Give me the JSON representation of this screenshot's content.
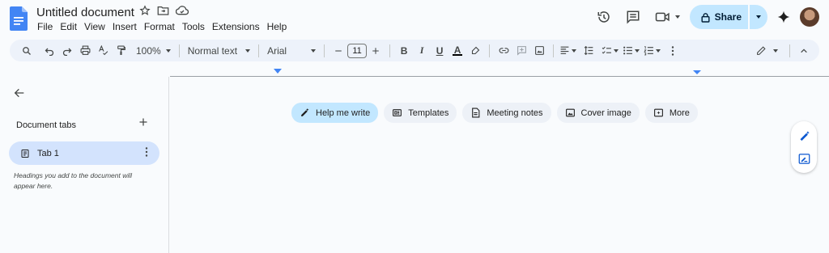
{
  "doc": {
    "title": "Untitled document"
  },
  "menu": [
    "File",
    "Edit",
    "View",
    "Insert",
    "Format",
    "Tools",
    "Extensions",
    "Help"
  ],
  "share": {
    "label": "Share"
  },
  "toolbar": {
    "zoom": "100%",
    "style": "Normal text",
    "font": "Arial",
    "font_size": "11"
  },
  "sidebar": {
    "section_label": "Document tabs",
    "tab_label": "Tab 1",
    "hint": "Headings you add to the document will appear here."
  },
  "chips": [
    {
      "label": "Help me write",
      "icon": "pen-sparkle-icon"
    },
    {
      "label": "Templates",
      "icon": "templates-icon"
    },
    {
      "label": "Meeting notes",
      "icon": "doc-icon"
    },
    {
      "label": "Cover image",
      "icon": "image-icon"
    },
    {
      "label": "More",
      "icon": "more-icon"
    }
  ],
  "colors": {
    "accent": "#c2e7ff",
    "toolbar": "#edf2fa",
    "tab_selected": "#d3e3fd",
    "docs_blue": "#4285f4"
  }
}
